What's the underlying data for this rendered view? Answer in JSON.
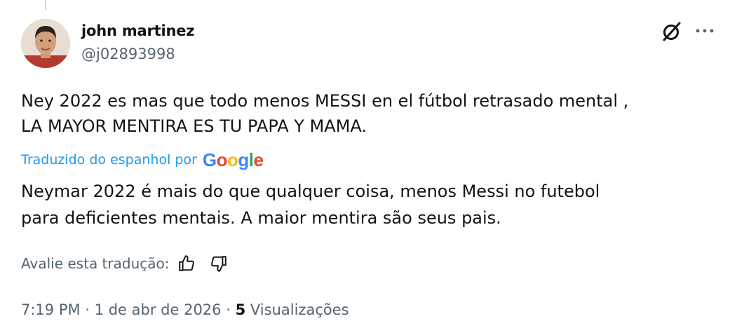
{
  "tweet": {
    "author_name": "john martinez",
    "author_handle": "@j02893998",
    "text": "Ney 2022 es mas que todo menos MESSI en el fútbol retrasado mental ,\nLA MAYOR MENTIRA ES TU PAPA Y MAMA.",
    "translated_by_label": "Traduzido do espanhol por",
    "translation_provider": "Google",
    "translation_text": "Neymar 2022 é mais do que qualquer coisa, menos Messi no futebol\npara deficientes mentais. A maior mentira são seus pais.",
    "rate_translation_label": "Avalie esta tradução:",
    "time": "7:19 PM",
    "separator": "·",
    "date": "1 de abr de 2026",
    "view_count": "5",
    "views_label": "Visualizações"
  },
  "icons": {
    "grok": "grok-icon",
    "more": "more-icon",
    "thumbs_up": "thumbs-up-icon",
    "thumbs_down": "thumbs-down-icon"
  },
  "colors": {
    "link": "#1d9bf0",
    "secondary_text": "#536471",
    "primary_text": "#0f1419",
    "google_blue": "#4285F4",
    "google_red": "#EA4335",
    "google_yellow": "#FBBC05",
    "google_green": "#34A853"
  }
}
